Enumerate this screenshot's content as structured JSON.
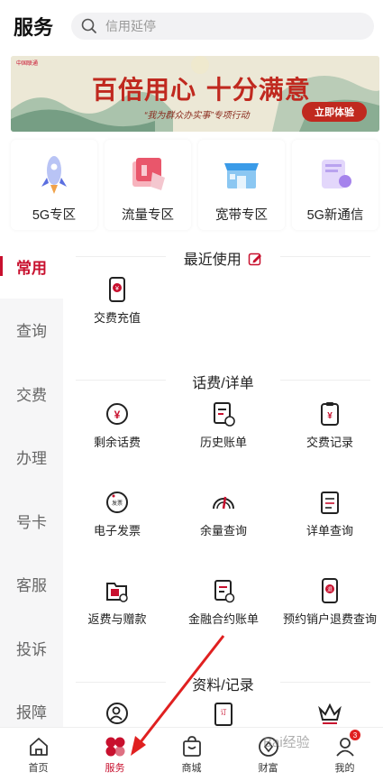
{
  "header": {
    "title": "服务",
    "search_placeholder": "信用延停"
  },
  "banner": {
    "logo_text": "中国联通",
    "main": "百倍用心 十分满意",
    "sub": "“我为群众办实事”专项行动",
    "button": "立即体验"
  },
  "cards": [
    {
      "label": "5G专区",
      "icon": "rocket-icon"
    },
    {
      "label": "流量专区",
      "icon": "data-traffic-icon"
    },
    {
      "label": "宽带专区",
      "icon": "broadband-store-icon"
    },
    {
      "label": "5G新通信",
      "icon": "new-comm-icon"
    }
  ],
  "sidebar": {
    "items": [
      "常用",
      "查询",
      "交费",
      "办理",
      "号卡",
      "客服",
      "投诉",
      "报障"
    ],
    "active": "常用"
  },
  "content": {
    "recent": {
      "title": "最近使用",
      "items": [
        {
          "label": "交费充值"
        }
      ]
    },
    "bill": {
      "title": "话费/详单",
      "items": [
        {
          "label": "剩余话费"
        },
        {
          "label": "历史账单"
        },
        {
          "label": "交费记录"
        },
        {
          "label": "电子发票"
        },
        {
          "label": "余量查询"
        },
        {
          "label": "详单查询"
        },
        {
          "label": "返费与赠款"
        },
        {
          "label": "金融合约账单"
        },
        {
          "label": "预约销户退费查询"
        }
      ]
    },
    "records": {
      "title": "资料/记录"
    }
  },
  "tabbar": {
    "items": [
      {
        "label": "首页",
        "icon": "home-icon"
      },
      {
        "label": "服务",
        "icon": "service-icon"
      },
      {
        "label": "商城",
        "icon": "mall-bag-icon"
      },
      {
        "label": "财富",
        "icon": "wealth-icon"
      },
      {
        "label": "我的",
        "icon": "profile-icon"
      }
    ],
    "badge": "3"
  },
  "watermark": "Bai经验",
  "colors": {
    "accent": "#c8102e"
  }
}
